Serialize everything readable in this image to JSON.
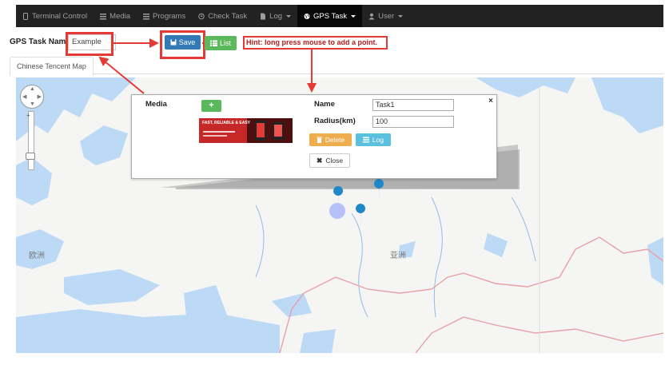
{
  "nav": {
    "items": [
      {
        "label": "Terminal Control",
        "icon": "phone-icon"
      },
      {
        "label": "Media",
        "icon": "list-icon"
      },
      {
        "label": "Programs",
        "icon": "list-icon"
      },
      {
        "label": "Check Task",
        "icon": "clock-icon"
      },
      {
        "label": "Log",
        "icon": "file-icon",
        "dropdown": true
      },
      {
        "label": "GPS Task",
        "icon": "globe-icon",
        "dropdown": true,
        "active": true
      },
      {
        "label": "User",
        "icon": "user-icon",
        "dropdown": true
      }
    ]
  },
  "task": {
    "name_label": "GPS Task Name",
    "name_value": "Example",
    "save_label": "Save",
    "list_label": "List",
    "hint": "Hint: long press mouse to add a point."
  },
  "tabs": [
    {
      "label": "Chinese Tencent Map"
    }
  ],
  "map": {
    "labels": {
      "europe": "欧洲",
      "asia": "亚洲"
    }
  },
  "popup": {
    "media_label": "Media",
    "add_label": "+",
    "name_label": "Name",
    "name_value": "Task1",
    "radius_label": "Radius(km)",
    "radius_value": "100",
    "delete_label": "Delete",
    "log_label": "Log",
    "close_label": "Close",
    "close_x": "×",
    "banner_text": "FAST, RELIABLE & EASY"
  },
  "colors": {
    "navbar": "#222222",
    "save": "#337ab7",
    "list": "#5cb85c",
    "delete": "#f0ad4e",
    "log": "#5bc0de",
    "annotation": "#e53935",
    "water": "#bcd9f5",
    "border_line": "#e8a0a8",
    "marker": "#1e88c9"
  }
}
